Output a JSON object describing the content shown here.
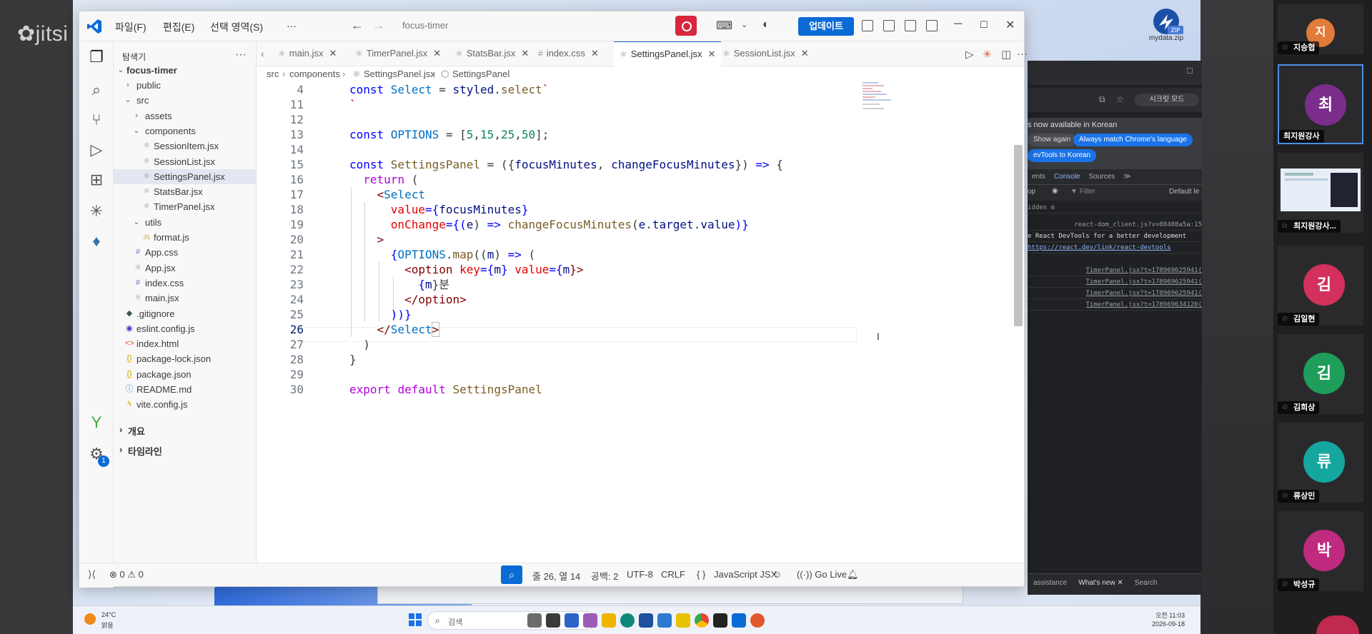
{
  "meeting": {
    "logo": "jitsi",
    "participants": [
      {
        "initial": "지",
        "name": "지승협",
        "color": "#e07b39"
      },
      {
        "initial": "최",
        "name": "최지원강사",
        "color": "#7b2d8b"
      },
      {
        "initial": "",
        "name": "최지원강사...",
        "color": "#1a73e8"
      },
      {
        "initial": "김",
        "name": "김일현",
        "color": "#d3305b"
      },
      {
        "initial": "김",
        "name": "김희상",
        "color": "#1e9e5a"
      },
      {
        "initial": "류",
        "name": "류상민",
        "color": "#16a6a0"
      },
      {
        "initial": "박",
        "name": "박성규",
        "color": "#c02a7f"
      }
    ]
  },
  "desktop": {
    "zip_label": "ZIP",
    "zip_filename": "mydata.zip"
  },
  "devtools": {
    "incognito": "시크릿 모드",
    "notice": "s now available in Korean",
    "btn_show_again": "Show again",
    "btn_always_match": "Always match Chrome's language",
    "btn_switch": "evTools to Korean",
    "tabs": [
      "ents",
      "Console",
      "Sources",
      "≫"
    ],
    "filter_top": "op",
    "filter_label": "Filter",
    "filter_level": "Default le",
    "hidden": "idden",
    "log_lines": [
      "react-dom_client.js?v=88408a5a:15",
      "e React DevTools for a better development",
      "https://react.dev/link/react-devtools",
      "TimerPanel.jsx?t=178969625941(",
      "TimerPanel.jsx?t=178969625941(",
      "TimerPanel.jsx?t=178969625941(",
      "TimerPanel.jsx?t=178969634120("
    ],
    "bottom_tabs": [
      "assistance",
      "What's new ✕",
      "Search"
    ]
  },
  "taskbar": {
    "temp": "24°C",
    "weather": "맑음",
    "search_placeholder": "검색",
    "time": "오전 11:03",
    "date": "2026-09-18"
  },
  "vscode": {
    "menu": [
      "파일(F)",
      "편집(E)",
      "선택 영역(S)",
      "···"
    ],
    "search": "focus-timer",
    "update_button": "업데이트",
    "explorer_title": "탐색기",
    "project": "focus-timer",
    "tree": [
      {
        "label": "public",
        "depth": 1,
        "type": "folder-closed",
        "icon": ""
      },
      {
        "label": "src",
        "depth": 1,
        "type": "folder-open",
        "icon": ""
      },
      {
        "label": "assets",
        "depth": 2,
        "type": "folder-closed",
        "icon": ""
      },
      {
        "label": "components",
        "depth": 2,
        "type": "folder-open",
        "icon": ""
      },
      {
        "label": "SessionItem.jsx",
        "depth": 3,
        "type": "file",
        "icon": "⚛"
      },
      {
        "label": "SessionList.jsx",
        "depth": 3,
        "type": "file",
        "icon": "⚛"
      },
      {
        "label": "SettingsPanel.jsx",
        "depth": 3,
        "type": "file",
        "icon": "⚛",
        "selected": true
      },
      {
        "label": "StatsBar.jsx",
        "depth": 3,
        "type": "file",
        "icon": "⚛"
      },
      {
        "label": "TimerPanel.jsx",
        "depth": 3,
        "type": "file",
        "icon": "⚛"
      },
      {
        "label": "utils",
        "depth": 2,
        "type": "folder-open",
        "icon": ""
      },
      {
        "label": "format.js",
        "depth": 3,
        "type": "file",
        "icon": "JS"
      },
      {
        "label": "App.css",
        "depth": 2,
        "type": "file",
        "icon": "#"
      },
      {
        "label": "App.jsx",
        "depth": 2,
        "type": "file",
        "icon": "⚛"
      },
      {
        "label": "index.css",
        "depth": 2,
        "type": "file",
        "icon": "#"
      },
      {
        "label": "main.jsx",
        "depth": 2,
        "type": "file",
        "icon": "⚛"
      },
      {
        "label": ".gitignore",
        "depth": 1,
        "type": "file",
        "icon": "◆"
      },
      {
        "label": "eslint.config.js",
        "depth": 1,
        "type": "file",
        "icon": "◉"
      },
      {
        "label": "index.html",
        "depth": 1,
        "type": "file",
        "icon": "<>"
      },
      {
        "label": "package-lock.json",
        "depth": 1,
        "type": "file",
        "icon": "{}"
      },
      {
        "label": "package.json",
        "depth": 1,
        "type": "file",
        "icon": "{}"
      },
      {
        "label": "README.md",
        "depth": 1,
        "type": "file",
        "icon": "ⓘ"
      },
      {
        "label": "vite.config.js",
        "depth": 1,
        "type": "file",
        "icon": "ϟ"
      }
    ],
    "outline": "개요",
    "timeline": "타임라인",
    "tabs": [
      {
        "label": "main.jsx",
        "icon": "⚛"
      },
      {
        "label": "TimerPanel.jsx",
        "icon": "⚛"
      },
      {
        "label": "StatsBar.jsx",
        "icon": "⚛"
      },
      {
        "label": "index.css",
        "icon": "#"
      },
      {
        "label": "SettingsPanel.jsx",
        "icon": "⚛",
        "active": true
      },
      {
        "label": "SessionList.jsx",
        "icon": "⚛"
      }
    ],
    "breadcrumb": [
      "src",
      "components",
      "SettingsPanel.jsx",
      "SettingsPanel"
    ],
    "line_numbers": [
      "4",
      "11",
      "12",
      "13",
      "14",
      "15",
      "16",
      "17",
      "18",
      "19",
      "20",
      "21",
      "22",
      "23",
      "24",
      "25",
      "26",
      "27",
      "28",
      "29",
      "30"
    ],
    "current_line": "26",
    "code": {
      "l4a": "const ",
      "l4b": "Select",
      "l4c": " = ",
      "l4d": "styled",
      "l4e": ".",
      "l4f": "select",
      "l4g": "`",
      "l11": "`",
      "l13a": "const ",
      "l13b": "OPTIONS",
      "l13c": " = [",
      "l13d": "5",
      "l13e": ",",
      "l13f": "15",
      "l13g": ",",
      "l13h": "25",
      "l13i": ",",
      "l13j": "50",
      "l13k": "];",
      "l15a": "const ",
      "l15b": "SettingsPanel",
      "l15c": " = ({",
      "l15d": "focusMinutes",
      "l15e": ", ",
      "l15f": "changeFocusMinutes",
      "l15g": "}) ",
      "l15h": "=>",
      "l15i": " {",
      "l16a": "  ",
      "l16b": "return",
      "l16c": " (",
      "l17a": "    <",
      "l17b": "Select",
      "l18a": "      ",
      "l18b": "value",
      "l18c": "={",
      "l18d": "focusMinutes",
      "l18e": "}",
      "l19a": "      ",
      "l19b": "onChange",
      "l19c": "={(",
      "l19d": "e",
      "l19e": ") ",
      "l19f": "=>",
      "l19g": " ",
      "l19h": "changeFocusMinutes",
      "l19i": "(",
      "l19j": "e",
      "l19k": ".",
      "l19l": "target",
      "l19m": ".",
      "l19n": "value",
      "l19o": ")}",
      "l20": "    >",
      "l21a": "      {",
      "l21b": "OPTIONS",
      "l21c": ".",
      "l21d": "map",
      "l21e": "((",
      "l21f": "m",
      "l21g": ") ",
      "l21h": "=>",
      "l21i": " (",
      "l22a": "        <",
      "l22b": "option",
      "l22c": " ",
      "l22d": "key",
      "l22e": "={",
      "l22f": "m",
      "l22g": "} ",
      "l22h": "value",
      "l22i": "={",
      "l22j": "m",
      "l22k": "}>",
      "l23a": "          {",
      "l23b": "m",
      "l23c": "}분",
      "l24a": "        </",
      "l24b": "option",
      "l24c": ">",
      "l25": "      ))}",
      "l26a": "    </",
      "l26b": "Select",
      "l26c": ">",
      "l27": "  )",
      "l28": "}",
      "l30a": "export",
      "l30b": " ",
      "l30c": "default",
      "l30d": " ",
      "l30e": "SettingsPanel"
    },
    "status": {
      "problems": "⊗ 0 ⚠ 0",
      "position": "줄 26, 열 14",
      "spaces": "공백: 2",
      "encoding": "UTF-8",
      "eol": "CRLF",
      "language_icon": "{ }",
      "language": "JavaScript JSX",
      "golive": "Go Live"
    },
    "settings_badge": "1"
  }
}
